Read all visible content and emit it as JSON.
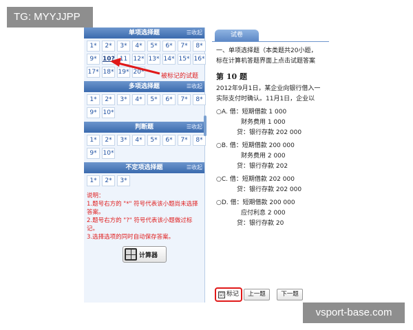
{
  "watermark_top": "TG: MYYJJPP",
  "watermark_bottom": "vsport-base.com",
  "sections": {
    "single": {
      "title": "单项选择题",
      "collapse": "收起",
      "rows": [
        [
          "1*",
          "2*",
          "3*",
          "4*",
          "5*",
          "6*",
          "7*",
          "8*"
        ],
        [
          "9*",
          "10?",
          "11",
          "12*",
          "13*",
          "14*",
          "15*",
          "16*"
        ],
        [
          "17*",
          "18*",
          "19*",
          "20*"
        ]
      ]
    },
    "multi": {
      "title": "多项选择题",
      "collapse": "收起",
      "rows": [
        [
          "1*",
          "2*",
          "3*",
          "4*",
          "5*",
          "6*",
          "7*",
          "8*"
        ],
        [
          "9*",
          "10*"
        ]
      ]
    },
    "judge": {
      "title": "判断题",
      "collapse": "收起",
      "rows": [
        [
          "1*",
          "2*",
          "3*",
          "4*",
          "5*",
          "6*",
          "7*",
          "8*"
        ],
        [
          "9*",
          "10*"
        ]
      ]
    },
    "indef": {
      "title": "不定项选择题",
      "collapse": "收起",
      "rows": [
        [
          "1*",
          "2*",
          "3*"
        ]
      ]
    }
  },
  "notes": [
    "说明：",
    "1.题号右方的 \"*\" 符号代表该小题尚未选择答案。",
    "2.题号右方的 \"?\" 符号代表该小题做过标记。",
    "3.选择选项的同时自动保存答案。"
  ],
  "calculator_label": "计算器",
  "annotation": "被标记的试题",
  "tab_label": "试卷",
  "intro_1": "一、单项选择题（本类题共20小题，",
  "intro_2": "标在计算机答题界面上点击试题答案",
  "question_no": "第 10 题",
  "question_1": "2012年9月1日，某企业向银行借入一",
  "question_2": "实际支付时确认。11月1日，企业以",
  "option_a": {
    "l1": "○A. 借：短期借款    1 000",
    "l2": "财务费用    1 000",
    "l3": "贷：银行存款        202 000"
  },
  "option_b": {
    "l1": "○B. 借：短期借款   200 000",
    "l2": "财务费用     2 000",
    "l3": "贷：银行存款        202"
  },
  "option_c": {
    "l1": "○C. 借：短期借款   202 000",
    "l2": "贷：银行存款        202 000"
  },
  "option_d": {
    "l1": "○D. 借：短期借款     200 000",
    "l2": "应付利息      2 000",
    "l3": "贷：银行存款        20"
  },
  "mark_label": "标记",
  "mark_checked": "☑",
  "prev_label": "上一题",
  "next_label": "下一题",
  "colors": {
    "accent": "#e01818",
    "header": "#3a6aae",
    "link": "#2253a3"
  }
}
